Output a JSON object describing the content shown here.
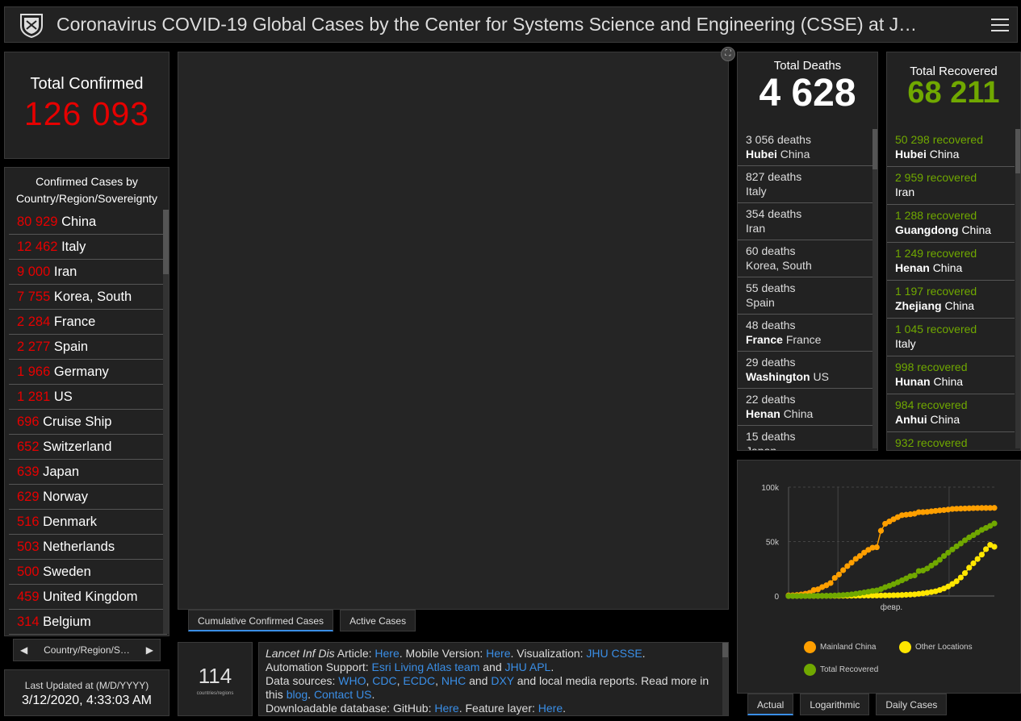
{
  "header": {
    "title": "Coronavirus COVID-19 Global Cases by the Center for Systems Science and Engineering (CSSE) at J…"
  },
  "total_confirmed": {
    "label": "Total Confirmed",
    "value": "126 093"
  },
  "country_list": {
    "header": "Confirmed Cases by Country/Region/Sovereignty",
    "items": [
      {
        "count": "80 929",
        "name": "China"
      },
      {
        "count": "12 462",
        "name": "Italy"
      },
      {
        "count": "9 000",
        "name": "Iran"
      },
      {
        "count": "7 755",
        "name": "Korea, South"
      },
      {
        "count": "2 284",
        "name": "France"
      },
      {
        "count": "2 277",
        "name": "Spain"
      },
      {
        "count": "1 966",
        "name": "Germany"
      },
      {
        "count": "1 281",
        "name": "US"
      },
      {
        "count": "696",
        "name": "Cruise Ship"
      },
      {
        "count": "652",
        "name": "Switzerland"
      },
      {
        "count": "639",
        "name": "Japan"
      },
      {
        "count": "629",
        "name": "Norway"
      },
      {
        "count": "516",
        "name": "Denmark"
      },
      {
        "count": "503",
        "name": "Netherlands"
      },
      {
        "count": "500",
        "name": "Sweden"
      },
      {
        "count": "459",
        "name": "United Kingdom"
      },
      {
        "count": "314",
        "name": "Belgium"
      }
    ],
    "pager_label": "Country/Region/S…"
  },
  "last_updated": {
    "label": "Last Updated at (M/D/YYYY)",
    "value": "3/12/2020, 4:33:03 AM"
  },
  "map_tabs": [
    "Cumulative Confirmed Cases",
    "Active Cases"
  ],
  "country_count": {
    "value": "114",
    "label": "countries/regions"
  },
  "info": {
    "line1": {
      "journal": "Lancet Inf Dis",
      "article": " Article: ",
      "here1": "Here",
      "mobile": ". Mobile Version: ",
      "here2": "Here",
      "vis": ". Visualization: ",
      "jhu": "JHU CSSE",
      "end": "."
    },
    "line2": {
      "pre": "Automation Support: ",
      "esri": "Esri Living Atlas team",
      "and": " and ",
      "apl": "JHU APL",
      "end": "."
    },
    "line3": {
      "pre": "Data sources: ",
      "who": "WHO",
      "cdc": "CDC",
      "ecdc": "ECDC",
      "nhc": "NHC",
      "and": " and ",
      "dxy": "DXY",
      "post": " and local media reports. Read more in this ",
      "blog": "blog",
      "sep": ". ",
      "contact": "Contact US",
      "end": "."
    },
    "line4": {
      "pre": "Downloadable database: GitHub: ",
      "here": "Here",
      "mid": ". Feature layer: ",
      "here2": "Here",
      "end": "."
    }
  },
  "total_deaths": {
    "label": "Total Deaths",
    "value": "4 628",
    "items": [
      {
        "count": "3 056",
        "unit": "deaths",
        "place": "Hubei",
        "region": "China"
      },
      {
        "count": "827",
        "unit": "deaths",
        "place": "",
        "region": "Italy"
      },
      {
        "count": "354",
        "unit": "deaths",
        "place": "",
        "region": "Iran"
      },
      {
        "count": "60",
        "unit": "deaths",
        "place": "",
        "region": "Korea, South"
      },
      {
        "count": "55",
        "unit": "deaths",
        "place": "",
        "region": "Spain"
      },
      {
        "count": "48",
        "unit": "deaths",
        "place": "France",
        "region": "France"
      },
      {
        "count": "29",
        "unit": "deaths",
        "place": "Washington",
        "region": "US"
      },
      {
        "count": "22",
        "unit": "deaths",
        "place": "Henan",
        "region": "China"
      },
      {
        "count": "15",
        "unit": "deaths",
        "place": "",
        "region": "Japan"
      }
    ]
  },
  "total_recovered": {
    "label": "Total Recovered",
    "value": "68 211",
    "items": [
      {
        "count": "50 298",
        "unit": "recovered",
        "place": "Hubei",
        "region": "China"
      },
      {
        "count": "2 959",
        "unit": "recovered",
        "place": "",
        "region": "Iran"
      },
      {
        "count": "1 288",
        "unit": "recovered",
        "place": "Guangdong",
        "region": "China"
      },
      {
        "count": "1 249",
        "unit": "recovered",
        "place": "Henan",
        "region": "China"
      },
      {
        "count": "1 197",
        "unit": "recovered",
        "place": "Zhejiang",
        "region": "China"
      },
      {
        "count": "1 045",
        "unit": "recovered",
        "place": "",
        "region": "Italy"
      },
      {
        "count": "998",
        "unit": "recovered",
        "place": "Hunan",
        "region": "China"
      },
      {
        "count": "984",
        "unit": "recovered",
        "place": "Anhui",
        "region": "China"
      },
      {
        "count": "932",
        "unit": "recovered",
        "place": "",
        "region": ""
      }
    ]
  },
  "chart_tabs": [
    "Actual",
    "Logarithmic",
    "Daily Cases"
  ],
  "colors": {
    "confirmed": "#e60000",
    "recovered": "#70a800",
    "mainland": "#ff9f00",
    "other": "#ffe600",
    "link": "#3a8ee6"
  },
  "chart_data": {
    "type": "scatter",
    "title": "",
    "ylim": [
      0,
      100000
    ],
    "yticks": [
      "100k",
      "50k",
      "0"
    ],
    "xtick": "февр.",
    "x": [
      0,
      1,
      2,
      3,
      4,
      5,
      6,
      7,
      8,
      9,
      10,
      11,
      12,
      13,
      14,
      15,
      16,
      17,
      18,
      19,
      20,
      21,
      22,
      23,
      24,
      25,
      26,
      27,
      28,
      29,
      30,
      31,
      32,
      33,
      34,
      35,
      36,
      37,
      38,
      39,
      40,
      41,
      42,
      43,
      44,
      45,
      46,
      47,
      48,
      49
    ],
    "series": [
      {
        "name": "Mainland China",
        "values": [
          548,
          643,
          920,
          1406,
          2075,
          2877,
          5509,
          6087,
          8141,
          9802,
          11891,
          16630,
          19716,
          23707,
          27440,
          30587,
          34110,
          36814,
          39829,
          42354,
          44386,
          44759,
          59895,
          66358,
          68413,
          70513,
          72434,
          74211,
          74619,
          75077,
          75550,
          77001,
          77022,
          77241,
          77754,
          78166,
          78600,
          78928,
          79356,
          79932,
          80136,
          80261,
          80386,
          80537,
          80690,
          80770,
          80823,
          80860,
          80887,
          80921
        ]
      },
      {
        "name": "Other Locations",
        "values": [
          7,
          12,
          15,
          22,
          35,
          46,
          60,
          80,
          92,
          125,
          135,
          150,
          160,
          180,
          200,
          260,
          300,
          320,
          360,
          390,
          420,
          450,
          500,
          530,
          600,
          690,
          770,
          900,
          1100,
          1300,
          1500,
          2000,
          2400,
          3000,
          3600,
          4300,
          5500,
          6900,
          8700,
          11000,
          13500,
          17000,
          21000,
          26000,
          30000,
          34000,
          38000,
          43000,
          47000,
          45200
        ]
      },
      {
        "name": "Total Recovered",
        "values": [
          28,
          30,
          36,
          39,
          52,
          61,
          107,
          126,
          143,
          222,
          284,
          472,
          623,
          852,
          1124,
          1487,
          2011,
          2616,
          3244,
          3946,
          4683,
          5150,
          6295,
          8058,
          9395,
          10865,
          12583,
          14352,
          16121,
          18177,
          18890,
          22886,
          23394,
          25227,
          27905,
          30384,
          33277,
          36711,
          39782,
          42716,
          45602,
          48228,
          51170,
          53796,
          55865,
          58358,
          60694,
          62494,
          64404,
          66578
        ]
      }
    ]
  }
}
